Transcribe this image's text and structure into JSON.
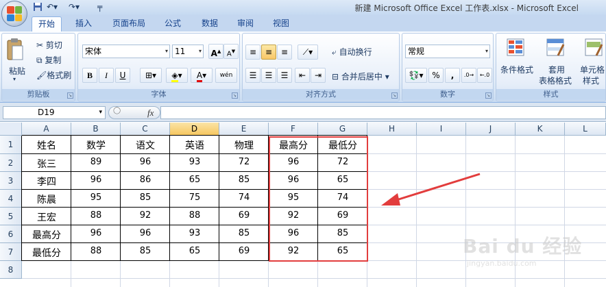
{
  "window": {
    "title": "新建 Microsoft Office Excel 工作表.xlsx - Microsoft Excel"
  },
  "tabs": [
    {
      "label": "开始",
      "active": true
    },
    {
      "label": "插入"
    },
    {
      "label": "页面布局"
    },
    {
      "label": "公式"
    },
    {
      "label": "数据"
    },
    {
      "label": "审阅"
    },
    {
      "label": "视图"
    }
  ],
  "ribbon": {
    "clipboard": {
      "label": "剪贴板",
      "paste": "粘贴",
      "cut": "剪切",
      "copy": "复制",
      "format_painter": "格式刷"
    },
    "font": {
      "label": "字体",
      "name": "宋体",
      "size": "11",
      "bold": "B",
      "italic": "I",
      "underline": "U",
      "grow": "A",
      "shrink": "A",
      "font_color": "A",
      "phonetic": "wén"
    },
    "alignment": {
      "label": "对齐方式",
      "wrap": "自动换行",
      "merge": "合并后居中"
    },
    "number": {
      "label": "数字",
      "format": "常规",
      "percent": "%",
      "comma": ","
    },
    "styles": {
      "label": "样式",
      "conditional": "条件格式",
      "table_style_1": "套用",
      "table_style_2": "表格格式",
      "cell_style_1": "单元格",
      "cell_style_2": "样式"
    }
  },
  "formula_bar": {
    "name_box": "D19",
    "fx": "fx",
    "value": ""
  },
  "sheet": {
    "columns": [
      "A",
      "B",
      "C",
      "D",
      "E",
      "F",
      "G",
      "H",
      "I",
      "J",
      "K",
      "L"
    ],
    "selected_column": "D",
    "rows": [
      "1",
      "2",
      "3",
      "4",
      "5",
      "6",
      "7",
      "8"
    ],
    "headers": [
      "姓名",
      "数学",
      "语文",
      "英语",
      "物理",
      "最高分",
      "最低分"
    ],
    "data": [
      [
        "张三",
        "89",
        "96",
        "93",
        "72",
        "96",
        "72"
      ],
      [
        "李四",
        "96",
        "86",
        "65",
        "85",
        "96",
        "65"
      ],
      [
        "陈晨",
        "95",
        "85",
        "75",
        "74",
        "95",
        "74"
      ],
      [
        "王宏",
        "88",
        "92",
        "88",
        "69",
        "92",
        "69"
      ],
      [
        "最高分",
        "96",
        "96",
        "93",
        "85",
        "96",
        "85"
      ],
      [
        "最低分",
        "88",
        "85",
        "65",
        "69",
        "92",
        "65"
      ]
    ]
  },
  "watermark": {
    "brand": "Bai du 经验",
    "url": "jingyan.baidu.com"
  },
  "colors": {
    "highlight_box": "#e23d3d",
    "arrow": "#e23d3d"
  }
}
